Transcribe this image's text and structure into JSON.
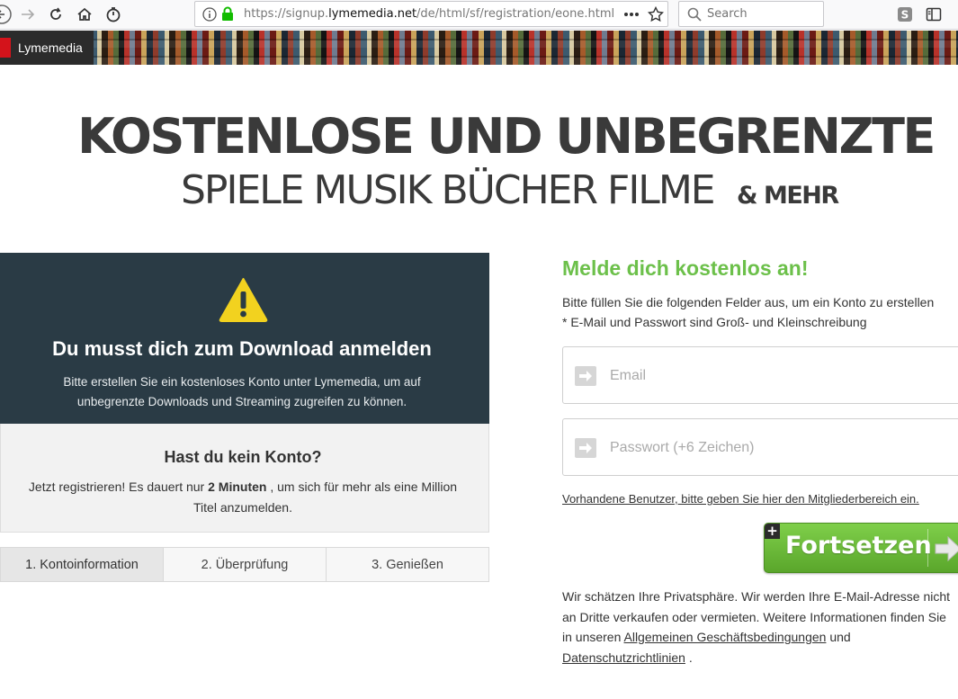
{
  "browser": {
    "url_prefix": "https://signup.",
    "url_domain": "lymemedia.net",
    "url_path": "/de/html/sf/registration/eone.html",
    "search_placeholder": "Search"
  },
  "banner": {
    "brand": "Lymemedia"
  },
  "headline": {
    "line1": "KOSTENLOSE UND UNBEGRENZTE",
    "line2": "SPIELE MUSIK BÜCHER FILME",
    "line2_more": "& MEHR"
  },
  "notice": {
    "title": "Du musst dich zum Download anmelden",
    "text": "Bitte erstellen Sie ein kostenloses Konto unter Lymemedia, um auf unbegrenzte Downloads und Streaming zugreifen zu können."
  },
  "account": {
    "title": "Hast du kein Konto?",
    "text_before": "Jetzt registrieren! Es dauert nur ",
    "text_bold": "2 Minuten",
    "text_after": " , um sich für mehr als eine Million Titel anzumelden."
  },
  "steps": [
    "1. Kontoinformation",
    "2. Überprüfung",
    "3. Genießen"
  ],
  "signup": {
    "title": "Melde dich kostenlos an!",
    "line1": "Bitte füllen Sie die folgenden Felder aus, um ein Konto zu erstellen",
    "line2": "* E-Mail und Passwort sind Groß- und Kleinschreibung",
    "email_placeholder": "Email",
    "password_placeholder": "Passwort (+6 Zeichen)",
    "members_link": "Vorhandene Benutzer, bitte geben Sie hier den Mitgliederbereich ein.",
    "continue_label": "Fortsetzen",
    "plus": "+"
  },
  "privacy": {
    "text1": "Wir schätzen Ihre Privatsphäre. Wir werden Ihre E-Mail-Adresse nicht an Dritte verkaufen oder vermieten. Weitere Informationen finden Sie in unseren ",
    "terms_link": "Allgemeinen Geschäftsbedingungen",
    "text2": " und ",
    "privacy_link": "Datenschutzrichtlinien",
    "text3": " ."
  },
  "colors": {
    "notice_bg": "#2a3b45",
    "accent_green": "#6cc04a",
    "warning_yellow": "#f2d21f",
    "brand_red": "#d4131b"
  }
}
